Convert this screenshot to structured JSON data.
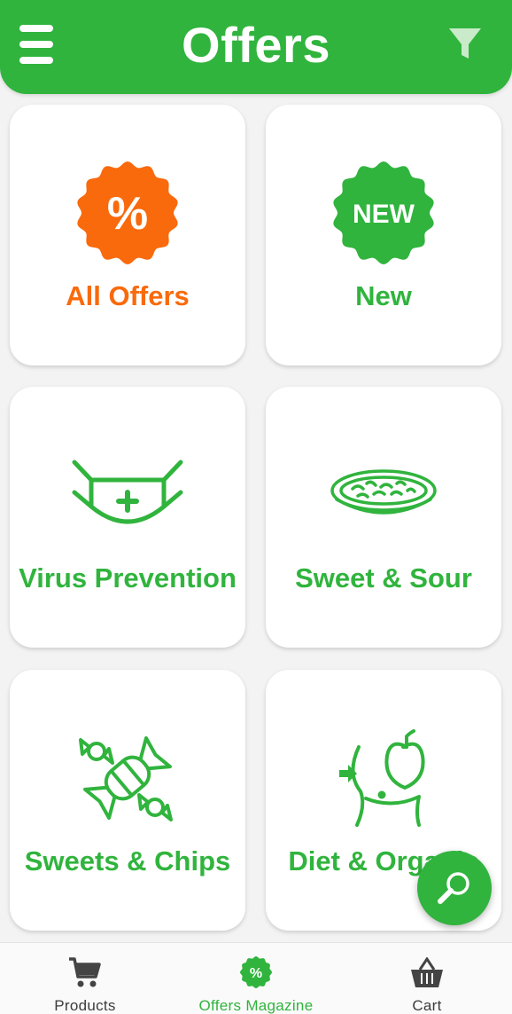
{
  "header": {
    "title": "Offers",
    "menu_icon": "hamburger-menu-icon",
    "filter_icon": "filter-funnel-icon",
    "color": "#30b43d"
  },
  "categories": [
    {
      "label": "All Offers",
      "icon": "percent-badge-icon",
      "color": "#f96a0c",
      "badge_text": "%"
    },
    {
      "label": "New",
      "icon": "new-badge-icon",
      "color": "#30b43d",
      "badge_text": "NEW"
    },
    {
      "label": "Virus Prevention",
      "icon": "face-mask-icon",
      "color": "#30b43d"
    },
    {
      "label": "Sweet & Sour",
      "icon": "salad-plate-icon",
      "color": "#30b43d"
    },
    {
      "label": "Sweets & Chips",
      "icon": "candy-icon",
      "color": "#30b43d"
    },
    {
      "label": "Diet & Organic",
      "icon": "diet-apple-icon",
      "color": "#30b43d"
    }
  ],
  "fab": {
    "icon": "search-magnifier-icon"
  },
  "bottom_nav": {
    "items": [
      {
        "label": "Products",
        "icon": "shopping-cart-icon",
        "active": false
      },
      {
        "label": "Offers Magazine",
        "icon": "offers-badge-icon",
        "active": true,
        "badge_text": "%"
      },
      {
        "label": "Cart",
        "icon": "shopping-basket-icon",
        "active": false
      }
    ],
    "active_color": "#30b43d"
  }
}
